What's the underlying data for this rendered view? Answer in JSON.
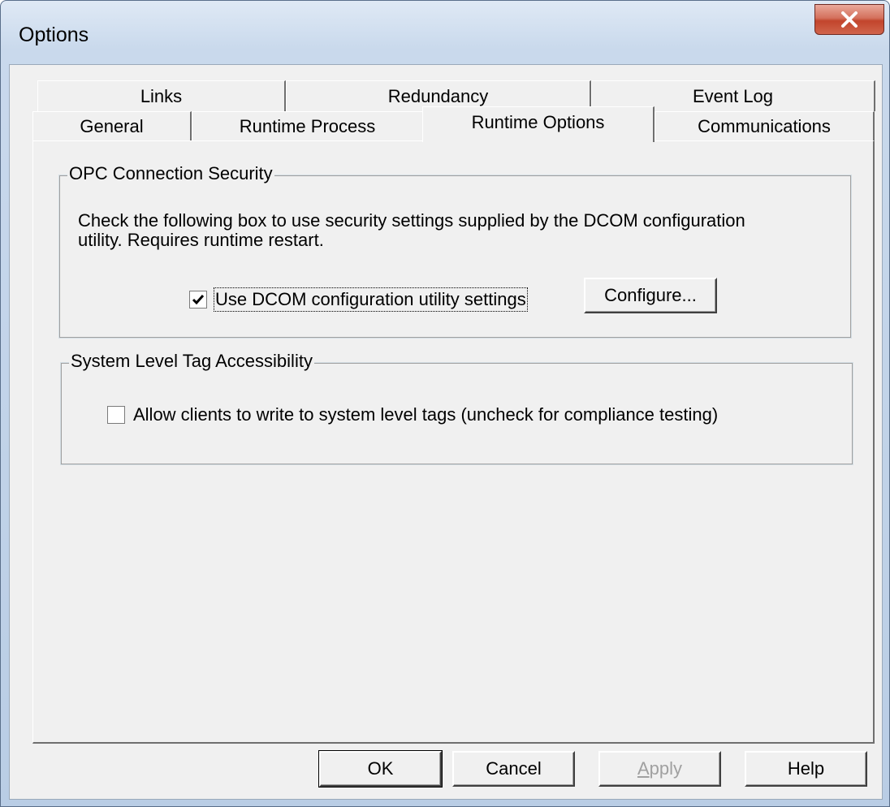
{
  "window": {
    "title": "Options",
    "close_glyph": "X"
  },
  "tabs": {
    "row1": [
      {
        "label": "Links"
      },
      {
        "label": "Redundancy"
      },
      {
        "label": "Event Log"
      }
    ],
    "row2": [
      {
        "label": "General"
      },
      {
        "label": "Runtime Process"
      },
      {
        "label": "Runtime Options",
        "selected": true
      },
      {
        "label": "Communications"
      }
    ]
  },
  "opc_security": {
    "legend": "OPC Connection Security",
    "description_line1": "Check the following box to use security settings supplied by the DCOM configuration",
    "description_line2": "utility.  Requires runtime restart.",
    "checkbox_label": "Use DCOM configuration utility settings",
    "checkbox_checked": true,
    "configure_label": "Configure..."
  },
  "system_tags": {
    "legend": "System Level Tag Accessibility",
    "checkbox_label": "Allow clients to write to system level tags (uncheck for compliance testing)",
    "checkbox_checked": false
  },
  "buttons": {
    "ok": "OK",
    "cancel": "Cancel",
    "apply_first": "A",
    "apply_rest": "pply",
    "apply_disabled": true,
    "help": "Help"
  },
  "icons": {
    "close": "close-icon",
    "check": "checkmark-icon"
  }
}
